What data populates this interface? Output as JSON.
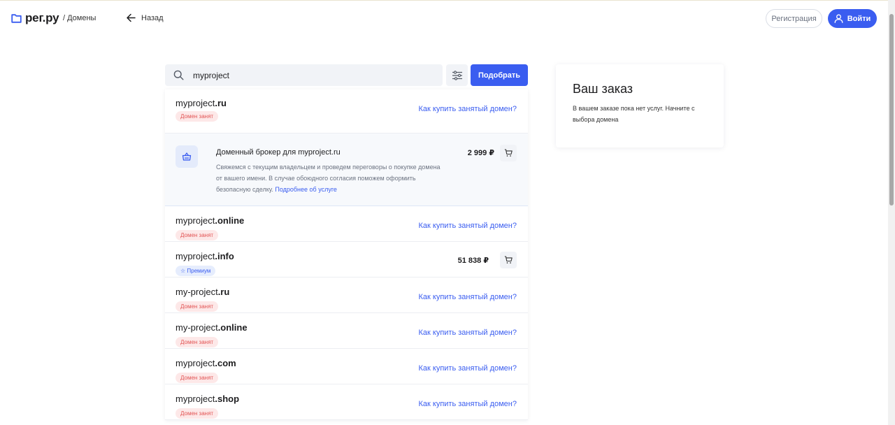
{
  "header": {
    "logo": "рег.ру",
    "breadcrumb": "/ Домены",
    "back_label": "Назад",
    "register_label": "Регистрация",
    "login_label": "Войти"
  },
  "search": {
    "value": "myproject",
    "pick_label": "Подобрать"
  },
  "results": [
    {
      "name": "myproject",
      "tld": ".ru",
      "badge": "Домен занят",
      "badge_type": "busy",
      "link": "Как купить занятый домен?"
    },
    {
      "name": "myproject",
      "tld": ".online",
      "badge": "Домен занят",
      "badge_type": "busy",
      "link": "Как купить занятый домен?"
    },
    {
      "name": "myproject",
      "tld": ".info",
      "badge": "Премиум",
      "badge_type": "premium",
      "price": "51 838 ₽"
    },
    {
      "name": "my-project",
      "tld": ".ru",
      "badge": "Домен занят",
      "badge_type": "busy",
      "link": "Как купить занятый домен?"
    },
    {
      "name": "my-project",
      "tld": ".online",
      "badge": "Домен занят",
      "badge_type": "busy",
      "link": "Как купить занятый домен?"
    },
    {
      "name": "myproject",
      "tld": ".com",
      "badge": "Домен занят",
      "badge_type": "busy",
      "link": "Как купить занятый домен?"
    },
    {
      "name": "myproject",
      "tld": ".shop",
      "badge": "Домен занят",
      "badge_type": "busy",
      "link": "Как купить занятый домен?"
    }
  ],
  "broker": {
    "title": "Доменный брокер для myproject.ru",
    "text": "Свяжемся с текущим владельцем и проведем переговоры о покупке домена от вашего имени. В случае обоюдного согласия поможем оформить безопасную сделку.",
    "link": "Подробнее об услуге",
    "price": "2 999 ₽"
  },
  "order": {
    "title": "Ваш заказ",
    "text": "В вашем заказе пока нет услуг. Начните с выбора домена"
  },
  "colors": {
    "accent": "#3a5df0",
    "busy_bg": "#fde8e8",
    "busy_text": "#e25555"
  }
}
